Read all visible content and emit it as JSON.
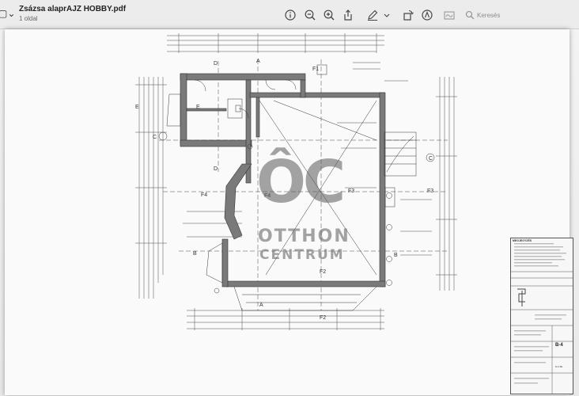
{
  "window": {
    "title": "Zsázsa alaprAJZ HOBBY.pdf",
    "subtitle": "1 oldal",
    "search_placeholder": "Keresés"
  },
  "toolbar": {
    "icons": [
      "info-icon",
      "zoom-out-icon",
      "zoom-in-icon",
      "share-icon",
      "pen-markup-icon",
      "chevron-down-icon",
      "rotate-icon",
      "annotate-icon",
      "signature-icon",
      "search-icon"
    ]
  },
  "watermark": {
    "logo": "ÔC",
    "line1": "OTTHON",
    "line2": "CENTRUM"
  },
  "plan_labels": {
    "a_top": "A",
    "a_bottom": "A",
    "b_left": "B",
    "b_right": "B",
    "c_left": "C",
    "c_right": "C",
    "d_top": "D",
    "d_mid": "D",
    "e_left": "E",
    "e_room": "E",
    "f1": "F1",
    "f2": "F2",
    "f2_bottom": "F2",
    "f3": "F3",
    "f3_right": "F3",
    "f4_left": "F4",
    "f4_mid": "F4"
  },
  "title_block": {
    "heading": "MEGJEGYZÉS",
    "sheet_no": "B-4",
    "scale": "M 1:50"
  },
  "colors": {
    "wall": "#7a7a7a",
    "line": "#3a3a3a",
    "page": "#fafafa"
  }
}
